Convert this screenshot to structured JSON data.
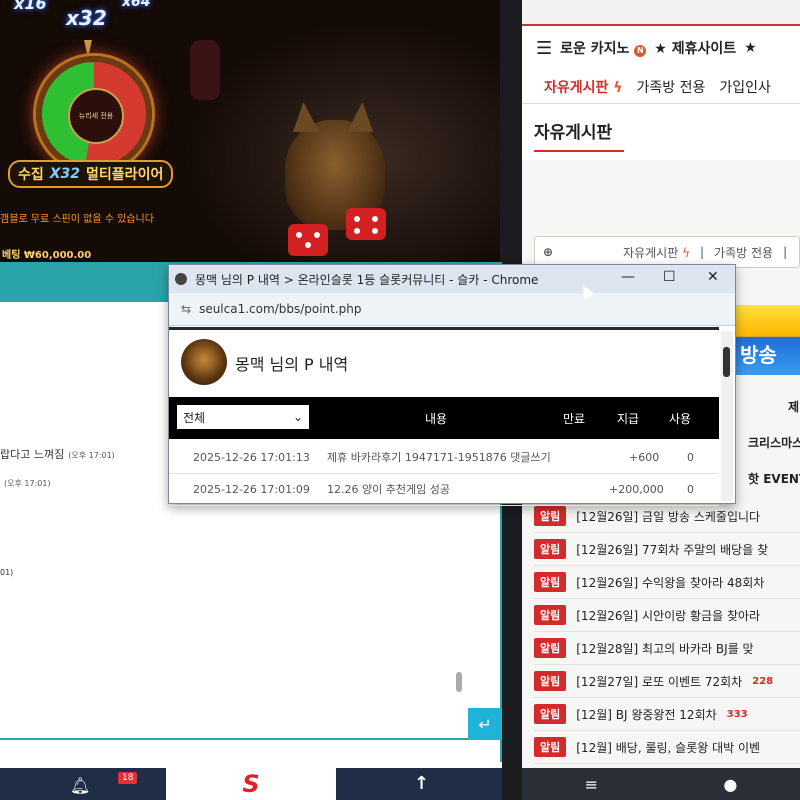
{
  "game": {
    "multipliers": [
      "x16",
      "x32",
      "x64"
    ],
    "wheel_center_label": "뉴리세 전용",
    "collect_label": "수집",
    "collect_multiplier": "X32",
    "collect_suffix": "멀티플라이어",
    "free_spin_note": "갬블로 무료 스핀이 없을 수 있습니다",
    "bet_label": "베팅 ₩60,000.00"
  },
  "right_panel": {
    "menu_items": [
      "로운 카지노",
      "★ 제휴사이트",
      "★"
    ],
    "menu_badge": "N",
    "tabs": [
      {
        "label": "자유게시판",
        "active": true
      },
      {
        "label": "가족방 전용",
        "active": false
      },
      {
        "label": "가입인사",
        "active": false
      }
    ],
    "title": "자유게시판",
    "breadcrumb": [
      "자유게시판",
      "가족방 전용"
    ],
    "banner_text": "방송",
    "partial_items": [
      "제",
      "크리스마스",
      "핫 EVENT"
    ],
    "notices": [
      {
        "badge": "알림",
        "text": "[12월26일] 금일 방송 스케줄입니다",
        "num": ""
      },
      {
        "badge": "알림",
        "text": "[12월26일] 77회차 주말의 배당을 찾",
        "num": ""
      },
      {
        "badge": "알림",
        "text": "[12월26일] 수익왕을 찾아라 48회차",
        "num": ""
      },
      {
        "badge": "알림",
        "text": "[12월26일] 시안이랑 황금을 찾아라",
        "num": ""
      },
      {
        "badge": "알림",
        "text": "[12월28일] 최고의 바카라 BJ를 맞",
        "num": ""
      },
      {
        "badge": "알림",
        "text": "[12월27일] 로또 이벤트 72회차",
        "num": "228"
      },
      {
        "badge": "알림",
        "text": "[12월] BJ 왕중왕전 12회차",
        "num": "333"
      },
      {
        "badge": "알림",
        "text": "[12월] 배당, 룰링, 슬롯왕 대박 이벤",
        "num": ""
      }
    ]
  },
  "chat": {
    "lines": [
      {
        "text": "랍다고 느껴짐",
        "time": "(오후 17:01)"
      },
      {
        "text": "",
        "time": "(오후 17:01)"
      },
      {
        "text": "01)",
        "time": ""
      }
    ]
  },
  "bottom_bar": {
    "notification_count": "18",
    "logo": "S"
  },
  "popup": {
    "window_title": "몽맥 님의 P 내역 > 온라인슬롯 1등 슬롯커뮤니티 - 슬카 - Chrome",
    "url": "seulca1.com/bbs/point.php",
    "heading": "몽맥 님의 P 내역",
    "filter_value": "전체",
    "columns": [
      "내용",
      "만료",
      "지급",
      "사용"
    ],
    "rows": [
      {
        "date": "2025-12-26 17:01:13",
        "content": "제휴 바카라후기 1947171-1951876 댓글쓰기",
        "expire": "",
        "given": "+600",
        "used": "0"
      },
      {
        "date": "2025-12-26 17:01:09",
        "content": "12.26 양이 추천게임 성공",
        "expire": "",
        "given": "+200,000",
        "used": "0"
      }
    ]
  }
}
